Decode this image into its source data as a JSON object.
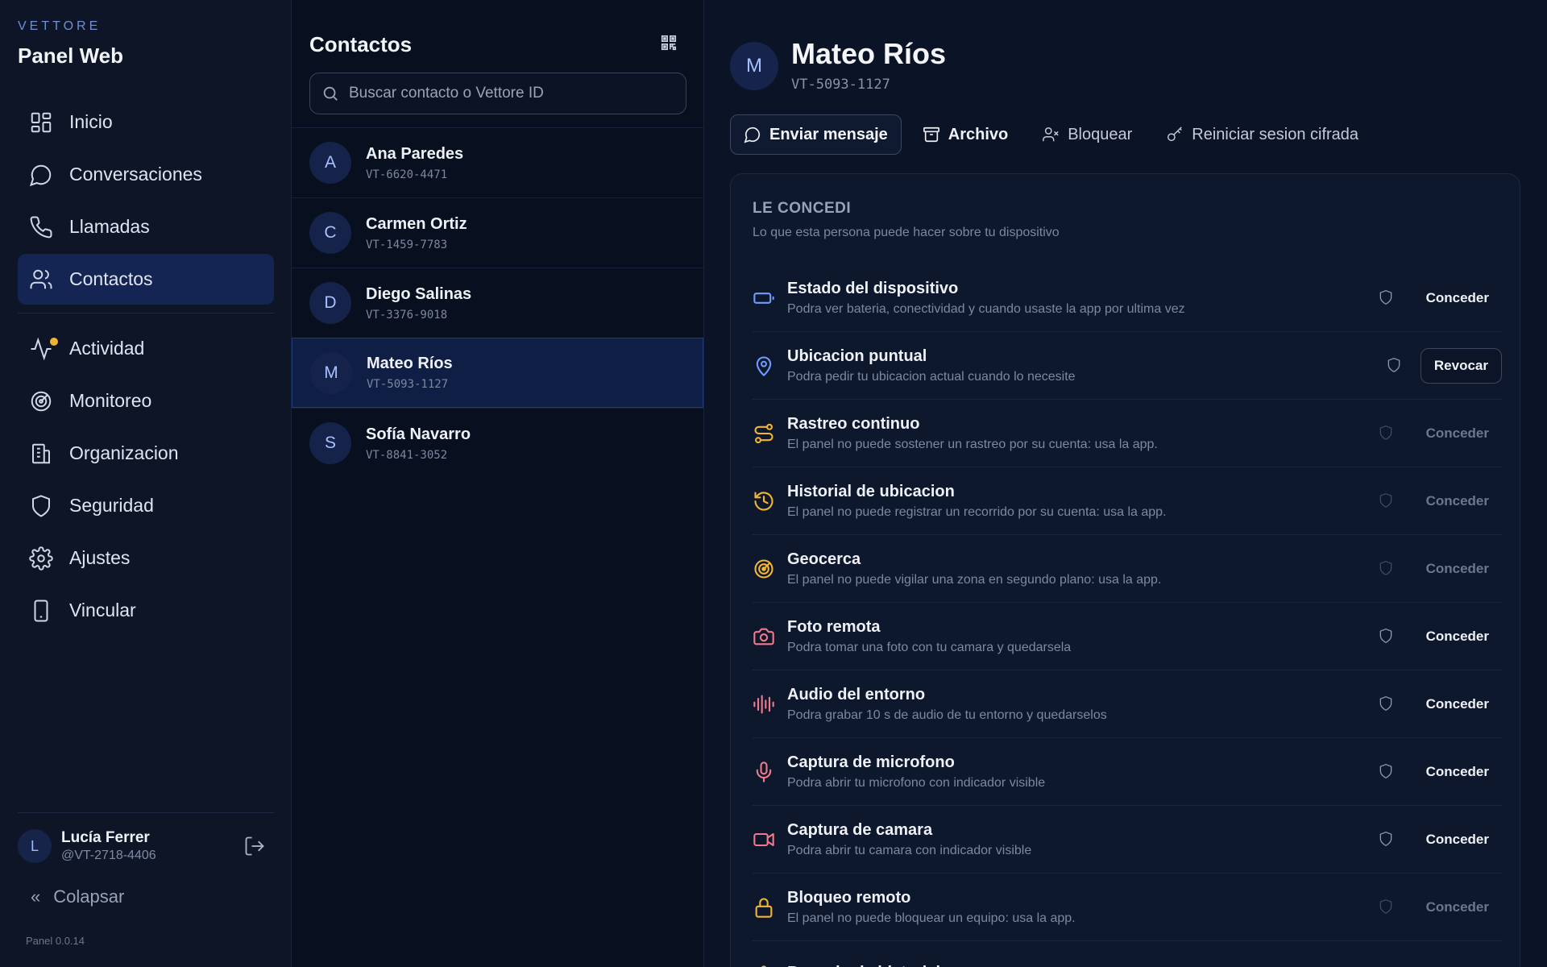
{
  "brand": {
    "kicker": "VETTORE",
    "title": "Panel Web"
  },
  "nav": {
    "items": [
      {
        "label": "Inicio",
        "icon": "grid-icon"
      },
      {
        "label": "Conversaciones",
        "icon": "chat-bubble-icon"
      },
      {
        "label": "Llamadas",
        "icon": "phone-icon"
      },
      {
        "label": "Contactos",
        "icon": "users-icon",
        "active": true
      }
    ],
    "items2": [
      {
        "label": "Actividad",
        "icon": "activity-icon",
        "badge": true
      },
      {
        "label": "Monitoreo",
        "icon": "radar-icon"
      },
      {
        "label": "Organizacion",
        "icon": "building-icon"
      },
      {
        "label": "Seguridad",
        "icon": "shield-icon"
      },
      {
        "label": "Ajustes",
        "icon": "gear-icon"
      },
      {
        "label": "Vincular",
        "icon": "smartphone-icon"
      }
    ]
  },
  "user": {
    "initial": "L",
    "name": "Lucía Ferrer",
    "id": "@VT-2718-4406"
  },
  "collapse": {
    "label": "Colapsar"
  },
  "version": "Panel 0.0.14",
  "contacts": {
    "title": "Contactos",
    "search_placeholder": "Buscar contacto o Vettore ID",
    "list": [
      {
        "initial": "A",
        "name": "Ana Paredes",
        "id": "VT-6620-4471"
      },
      {
        "initial": "C",
        "name": "Carmen Ortiz",
        "id": "VT-1459-7783"
      },
      {
        "initial": "D",
        "name": "Diego Salinas",
        "id": "VT-3376-9018"
      },
      {
        "initial": "M",
        "name": "Mateo Ríos",
        "id": "VT-5093-1127",
        "selected": true
      },
      {
        "initial": "S",
        "name": "Sofía Navarro",
        "id": "VT-8841-3052"
      }
    ]
  },
  "detail": {
    "initial": "M",
    "name": "Mateo Ríos",
    "id": "VT-5093-1127",
    "actions": {
      "send": "Enviar mensaje",
      "archive": "Archivo",
      "block": "Bloquear",
      "reset": "Reiniciar sesion cifrada"
    },
    "section_title": "LE CONCEDI",
    "section_sub": "Lo que esta persona puede hacer sobre tu dispositivo",
    "permissions": [
      {
        "title": "Estado del dispositivo",
        "desc": "Podra ver bateria, conectividad y cuando usaste la app por ultima vez",
        "action": "Conceder",
        "state": "enabled",
        "icon": "battery-icon",
        "color": "#6f9cff"
      },
      {
        "title": "Ubicacion puntual",
        "desc": "Podra pedir tu ubicacion actual cuando lo necesite",
        "action": "Revocar",
        "state": "revoke",
        "icon": "map-pin-icon",
        "color": "#6f9cff"
      },
      {
        "title": "Rastreo continuo",
        "desc": "El panel no puede sostener un rastreo por su cuenta: usa la app.",
        "action": "Conceder",
        "state": "disabled",
        "icon": "route-icon",
        "color": "#f2b531"
      },
      {
        "title": "Historial de ubicacion",
        "desc": "El panel no puede registrar un recorrido por su cuenta: usa la app.",
        "action": "Conceder",
        "state": "disabled",
        "icon": "history-icon",
        "color": "#f2b531"
      },
      {
        "title": "Geocerca",
        "desc": "El panel no puede vigilar una zona en segundo plano: usa la app.",
        "action": "Conceder",
        "state": "disabled",
        "icon": "target-icon",
        "color": "#f2b531"
      },
      {
        "title": "Foto remota",
        "desc": "Podra tomar una foto con tu camara y quedarsela",
        "action": "Conceder",
        "state": "enabled",
        "icon": "camera-icon",
        "color": "#f07a8c"
      },
      {
        "title": "Audio del entorno",
        "desc": "Podra grabar 10 s de audio de tu entorno y quedarselos",
        "action": "Conceder",
        "state": "enabled",
        "icon": "audio-wave-icon",
        "color": "#f07a8c"
      },
      {
        "title": "Captura de microfono",
        "desc": "Podra abrir tu microfono con indicador visible",
        "action": "Conceder",
        "state": "enabled",
        "icon": "microphone-icon",
        "color": "#f07a8c"
      },
      {
        "title": "Captura de camara",
        "desc": "Podra abrir tu camara con indicador visible",
        "action": "Conceder",
        "state": "enabled",
        "icon": "video-icon",
        "color": "#f07a8c"
      },
      {
        "title": "Bloqueo remoto",
        "desc": "El panel no puede bloquear un equipo: usa la app.",
        "action": "Conceder",
        "state": "disabled",
        "icon": "lock-icon",
        "color": "#f2b531"
      },
      {
        "title": "Borrado de historial",
        "desc": "",
        "action": "Conceder",
        "state": "disabled",
        "icon": "warning-icon",
        "color": "#f2b531"
      }
    ]
  },
  "colors": {
    "accent": "#6f9cff",
    "warning": "#f2b531",
    "danger": "#f07a8c",
    "active_bg": "#142554"
  }
}
